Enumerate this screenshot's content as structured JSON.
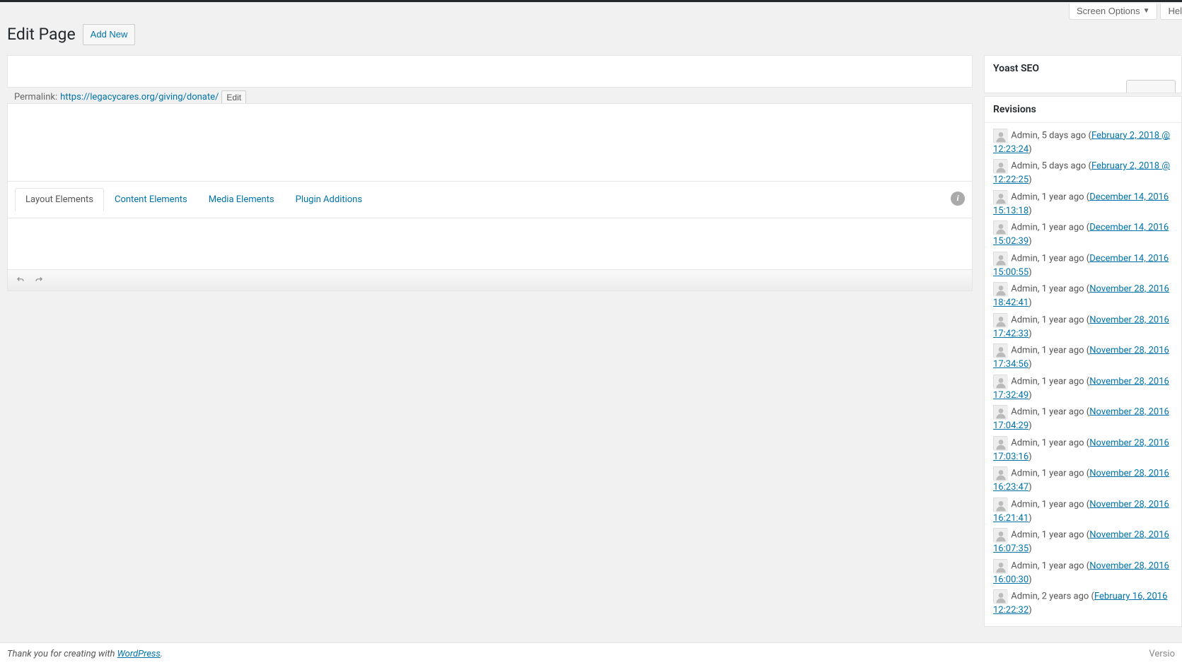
{
  "screen_options": {
    "label": "Screen Options",
    "help_label": "Hel"
  },
  "header": {
    "title": "Edit Page",
    "add_new_label": "Add New"
  },
  "permalink": {
    "label": "Permalink:",
    "url": "https://legacycares.org/giving/donate/",
    "edit_label": "Edit"
  },
  "tabs": [
    {
      "label": "Layout Elements",
      "active": true
    },
    {
      "label": "Content Elements",
      "active": false
    },
    {
      "label": "Media Elements",
      "active": false
    },
    {
      "label": "Plugin Additions",
      "active": false
    }
  ],
  "info_icon_char": "i",
  "yoast": {
    "title": "Yoast SEO"
  },
  "revisions_box": {
    "title": "Revisions"
  },
  "revisions": [
    {
      "author": "Admin",
      "ago": "5 days ago",
      "timestamp": "February 2, 2018 @ 12:23:24"
    },
    {
      "author": "Admin",
      "ago": "5 days ago",
      "timestamp": "February 2, 2018 @ 12:22:25"
    },
    {
      "author": "Admin",
      "ago": "1 year ago",
      "timestamp": "December 14, 2016 15:13:18"
    },
    {
      "author": "Admin",
      "ago": "1 year ago",
      "timestamp": "December 14, 2016 15:02:39"
    },
    {
      "author": "Admin",
      "ago": "1 year ago",
      "timestamp": "December 14, 2016 15:00:55"
    },
    {
      "author": "Admin",
      "ago": "1 year ago",
      "timestamp": "November 28, 2016 18:42:41"
    },
    {
      "author": "Admin",
      "ago": "1 year ago",
      "timestamp": "November 28, 2016 17:42:33"
    },
    {
      "author": "Admin",
      "ago": "1 year ago",
      "timestamp": "November 28, 2016 17:34:56"
    },
    {
      "author": "Admin",
      "ago": "1 year ago",
      "timestamp": "November 28, 2016 17:32:49"
    },
    {
      "author": "Admin",
      "ago": "1 year ago",
      "timestamp": "November 28, 2016 17:04:29"
    },
    {
      "author": "Admin",
      "ago": "1 year ago",
      "timestamp": "November 28, 2016 17:03:16"
    },
    {
      "author": "Admin",
      "ago": "1 year ago",
      "timestamp": "November 28, 2016 16:23:47"
    },
    {
      "author": "Admin",
      "ago": "1 year ago",
      "timestamp": "November 28, 2016 16:21:41"
    },
    {
      "author": "Admin",
      "ago": "1 year ago",
      "timestamp": "November 28, 2016 16:07:35"
    },
    {
      "author": "Admin",
      "ago": "1 year ago",
      "timestamp": "November 28, 2016 16:00:30"
    },
    {
      "author": "Admin",
      "ago": "2 years ago",
      "timestamp": "February 16, 2016 12:22:32"
    }
  ],
  "footer": {
    "thanks": "Thank you for creating with ",
    "wp": "WordPress",
    "period": ".",
    "version": "Versio"
  }
}
